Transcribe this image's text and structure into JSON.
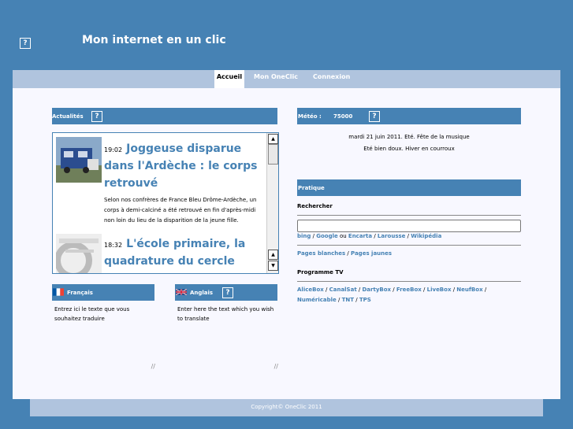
{
  "header": {
    "title": "Mon internet en un clic",
    "help_glyph": "?"
  },
  "nav": {
    "tabs": [
      "Accueil",
      "Mon OneClic",
      "Connexion"
    ],
    "active": "Accueil"
  },
  "news": {
    "title": "Actualités",
    "help_glyph": "?",
    "items": [
      {
        "time": "19:02",
        "headline": "Joggeuse disparue dans l'Ardèche : le corps retrouvé",
        "text": "Selon nos confrères de France Bleu Drôme-Ardèche, un corps à demi-calciné a été retrouvé en fin d'après-midi non loin du lieu de la disparition de la jeune fille."
      },
      {
        "time": "18:32",
        "headline": "L'école primaire, la quadrature du cercle"
      }
    ],
    "scroll_up": "▲",
    "scroll_down": "▼"
  },
  "translate": {
    "fr": {
      "label": "Français",
      "text": "Entrez ici le texte que vous souhaitez traduire"
    },
    "en": {
      "label": "Anglais",
      "text": "Enter here the text which you wish to translate",
      "help_glyph": "?"
    },
    "resize_glyph": "//"
  },
  "meteo": {
    "title": "Météo :",
    "postcode": "75000",
    "help_glyph": "?",
    "date_line": "mardi 21 juin 2011. Eté. Fête de la musique",
    "weather_line": "Eté bien doux. Hiver en courroux"
  },
  "pratique": {
    "title": "Pratique",
    "search_title": "Rechercher",
    "search_value": "",
    "search_links": [
      "bing",
      "Google",
      "Encarta",
      "Larousse",
      "Wikipédia"
    ],
    "sep_slash": " / ",
    "sep_ou": " ou ",
    "pages_links": [
      "Pages blanches",
      "Pages jaunes"
    ],
    "tv_title": "Programme TV",
    "tv_links": [
      "AliceBox",
      "CanalSat",
      "DartyBox",
      "FreeBox",
      "LiveBox",
      "NeufBox",
      "Numéricable",
      "TNT",
      "TPS"
    ]
  },
  "footer": {
    "text": "Copyright© OneClic 2011"
  },
  "colors": {
    "brand": "#4682b4",
    "light": "#b0c4de",
    "page": "#f8f8ff"
  }
}
